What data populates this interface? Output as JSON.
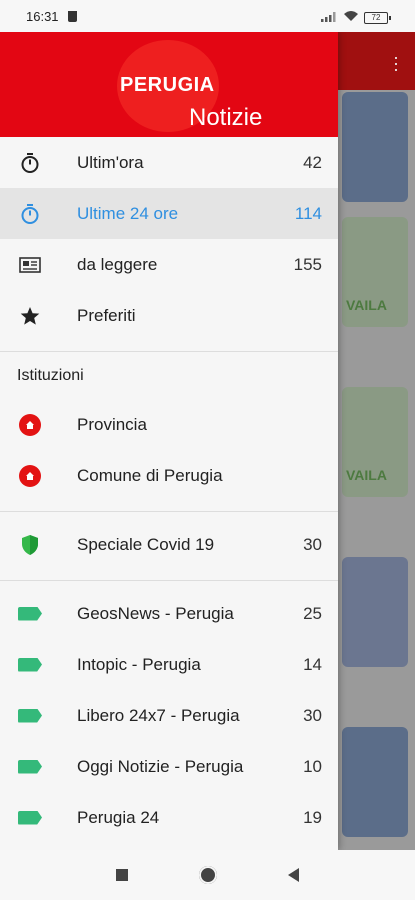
{
  "status_bar": {
    "time": "16:31",
    "battery": "72"
  },
  "header": {
    "brand_top": "PERUGIA",
    "brand_bottom": "Notizie"
  },
  "menu": [
    {
      "icon": "stopwatch-icon",
      "label": "Ultim'ora",
      "count": "42",
      "active": false
    },
    {
      "icon": "stopwatch-icon",
      "label": "Ultime 24 ore",
      "count": "114",
      "active": true
    },
    {
      "icon": "newspaper-icon",
      "label": "da leggere",
      "count": "155",
      "active": false
    },
    {
      "icon": "star-icon",
      "label": "Preferiti",
      "count": "",
      "active": false
    }
  ],
  "institutions": {
    "title": "Istituzioni",
    "items": [
      {
        "icon": "location-pin-icon",
        "label": "Provincia"
      },
      {
        "icon": "location-pin-icon",
        "label": "Comune di Perugia"
      }
    ]
  },
  "covid": {
    "icon": "shield-icon",
    "label": "Speciale Covid 19",
    "count": "30"
  },
  "sources": [
    {
      "icon": "tag-icon",
      "label": "GeosNews - Perugia",
      "count": "25"
    },
    {
      "icon": "tag-icon",
      "label": "Intopic - Perugia",
      "count": "14"
    },
    {
      "icon": "tag-icon",
      "label": "Libero 24x7 - Perugia",
      "count": "30"
    },
    {
      "icon": "tag-icon",
      "label": "Oggi Notizie - Perugia",
      "count": "10"
    },
    {
      "icon": "tag-icon",
      "label": "Perugia 24",
      "count": "19"
    }
  ],
  "background": {
    "thumb_text_1": "VAILA",
    "thumb_text_2": "VAILA"
  },
  "colors": {
    "brand_red": "#e30613",
    "active_blue": "#2f8fe0",
    "tag_green": "#34b97a",
    "pin_red": "#e31313"
  }
}
